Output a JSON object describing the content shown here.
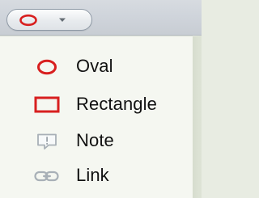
{
  "toolbar": {
    "selected_tool_icon": "oval-icon",
    "dropdown_icon": "chevron-down-icon"
  },
  "menu": {
    "items": [
      {
        "label": "Oval",
        "icon": "oval-icon",
        "color": "#d81f1f"
      },
      {
        "label": "Rectangle",
        "icon": "rectangle-icon",
        "color": "#d81f1f"
      },
      {
        "label": "Note",
        "icon": "note-icon",
        "color": "#a8b0b7"
      },
      {
        "label": "Link",
        "icon": "link-icon",
        "color": "#a8b0b7"
      }
    ]
  }
}
